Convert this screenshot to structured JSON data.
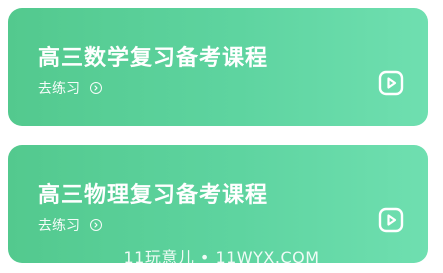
{
  "courses": [
    {
      "title": "高三数学复习备考课程",
      "action_label": "去练习",
      "action_icon": "chevron-right-circle-icon",
      "play_icon": "play-icon"
    },
    {
      "title": "高三物理复习备考课程",
      "action_label": "去练习",
      "action_icon": "chevron-right-circle-icon",
      "play_icon": "play-icon"
    }
  ],
  "watermark": "11玩意儿 • 11WYX.COM",
  "colors": {
    "card_gradient_start": "#53c98e",
    "card_gradient_end": "#6fdfb0",
    "text": "#ffffff"
  }
}
